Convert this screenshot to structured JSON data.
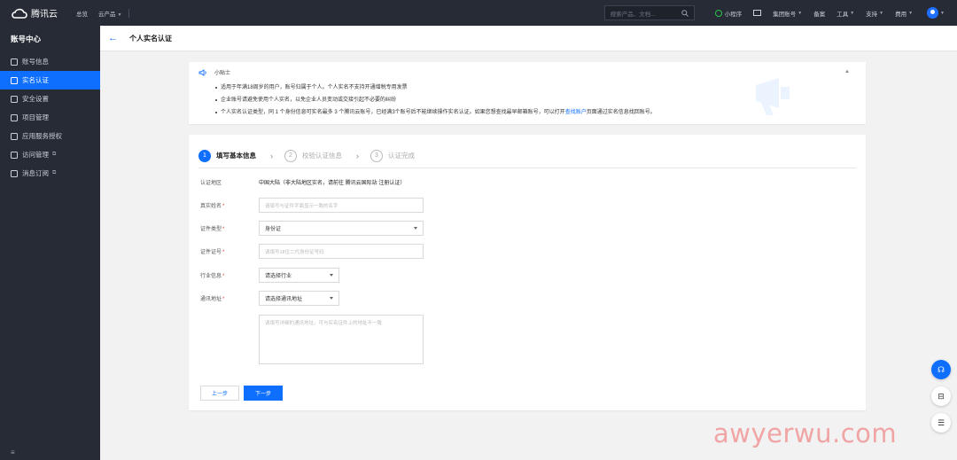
{
  "topbar": {
    "brand": "腾讯云",
    "nav": [
      "总览",
      "云产品"
    ],
    "search_placeholder": "搜索产品、文档...",
    "right_items": [
      "小程序",
      "集团账号",
      "备案",
      "工具",
      "支持",
      "费用"
    ]
  },
  "sidebar": {
    "title": "账号中心",
    "items": [
      {
        "label": "账号信息",
        "icon": "user-icon"
      },
      {
        "label": "实名认证",
        "icon": "id-card-icon",
        "active": true
      },
      {
        "label": "安全设置",
        "icon": "shield-icon"
      },
      {
        "label": "项目管理",
        "icon": "folder-icon"
      },
      {
        "label": "应用服务授权",
        "icon": "layers-icon"
      },
      {
        "label": "访问管理",
        "icon": "access-icon",
        "external": true
      },
      {
        "label": "消息订阅",
        "icon": "bell-icon",
        "external": true
      }
    ],
    "bottom_icon": "≡"
  },
  "header": {
    "back_icon": "←",
    "title": "个人实名认证"
  },
  "tips": {
    "title": "小贴士",
    "collapse": "▲",
    "items": [
      "适用于年满18周岁的用户，账号归属于个人。个人实名不支持开通增税专用发票",
      "企业账号请避免使用个人实名，以免企业人员变动或交接引起不必要的纠纷",
      "个人实名认证类型，同 1 个身份信息可实名最多 3 个腾讯云账号，已经满3个账号后不能继续操作实名认证。如果您想查找最早邮箱账号，可以打开"
    ],
    "link_text": "查找账户",
    "link_suffix": "页面通过实名信息找回账号。"
  },
  "steps": [
    {
      "num": "1",
      "label": "填写基本信息",
      "active": true
    },
    {
      "num": "2",
      "label": "校验认证信息"
    },
    {
      "num": "3",
      "label": "认证完成"
    }
  ],
  "form": {
    "region": {
      "label": "认证地区",
      "value": "中国大陆（非大陆地区实名，请前往 腾讯云国际站 注册认证）"
    },
    "name": {
      "label": "真实姓名",
      "placeholder": "请填写与证件字面显示一致的名字"
    },
    "id_type": {
      "label": "证件类型",
      "value": "身份证"
    },
    "id_number": {
      "label": "证件证号",
      "placeholder": "请填写18位二代身份证号码"
    },
    "industry": {
      "label": "行业信息",
      "value": "请选择行业"
    },
    "address": {
      "label": "通讯地址",
      "value": "请选择通讯地址",
      "detail_placeholder": "请填写详细的通讯地址，可与实名证件上的地址不一致"
    }
  },
  "buttons": {
    "prev": "上一步",
    "next": "下一步"
  },
  "float_buttons": [
    "headset-icon",
    "book-icon",
    "list-icon"
  ],
  "watermark": "awyerwu.com",
  "colors": {
    "accent": "#0e6fff",
    "dark": "#262b36",
    "required": "#e54545"
  }
}
